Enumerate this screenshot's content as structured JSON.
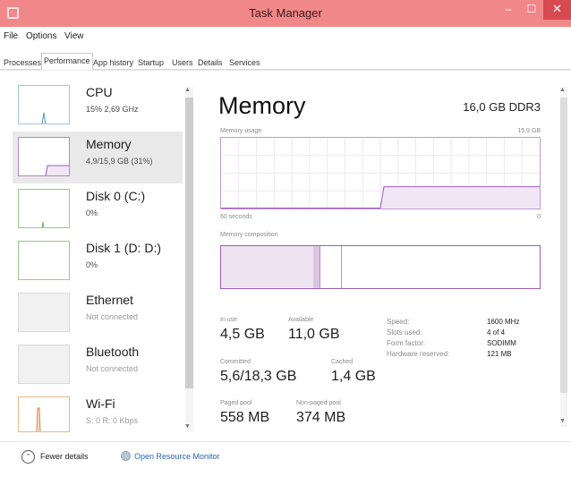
{
  "window": {
    "title": "Task Manager",
    "minimize_glyph": "–",
    "maximize_glyph": "☐",
    "close_glyph": "✕",
    "accent_color": "#f0888a"
  },
  "menu": [
    "File",
    "Options",
    "View"
  ],
  "tabs": [
    {
      "label": "Processes",
      "active": false
    },
    {
      "label": "Performance",
      "active": true
    },
    {
      "label": "App history",
      "active": false
    },
    {
      "label": "Startup",
      "active": false
    },
    {
      "label": "Users",
      "active": false
    },
    {
      "label": "Details",
      "active": false
    },
    {
      "label": "Services",
      "active": false
    }
  ],
  "sidebar": {
    "items": [
      {
        "name": "CPU",
        "sub": "15% 2,69 GHz",
        "icon": "cpu-graph-thumbnail"
      },
      {
        "name": "Memory",
        "sub": "4,9/15,9 GB (31%)",
        "icon": "memory-graph-thumbnail",
        "selected": true
      },
      {
        "name": "Disk 0 (C:)",
        "sub": "0%",
        "icon": "disk-graph-thumbnail"
      },
      {
        "name": "Disk 1 (D: D:)",
        "sub": "0%",
        "icon": "disk-graph-thumbnail"
      },
      {
        "name": "Ethernet",
        "sub": "Not connected",
        "icon": "ethernet-graph-thumbnail"
      },
      {
        "name": "Bluetooth",
        "sub": "Not connected",
        "icon": "bluetooth-graph-thumbnail"
      },
      {
        "name": "Wi-Fi",
        "sub": "S: 0 R: 0 Kbps",
        "icon": "wifi-graph-thumbnail"
      }
    ],
    "scroll_up_glyph": "▲",
    "scroll_down_glyph": "▼"
  },
  "memory": {
    "title": "Memory",
    "spec": "16,0 GB DDR3",
    "usage_graph": {
      "label": "Memory usage",
      "max_label": "15,9 GB",
      "time_label": "60 seconds",
      "min_label": "0",
      "line_color": "#9b5fb5",
      "fill_color": "#f1e6f5",
      "usage_before_gb": 0,
      "usage_after_gb": 4.9,
      "max_gb": 15.9,
      "step_at_fraction": 0.5
    },
    "composition": {
      "label": "Memory composition",
      "in_use_fraction": 0.29,
      "modified_fraction": 0.02
    },
    "stats": {
      "in_use_label": "In use",
      "in_use_value": "4,5 GB",
      "available_label": "Available",
      "available_value": "11,0 GB",
      "committed_label": "Committed",
      "committed_value": "5,6/18,3 GB",
      "cached_label": "Cached",
      "cached_value": "1,4 GB",
      "paged_label": "Paged pool",
      "paged_value": "558 MB",
      "nonpaged_label": "Non-paged pool",
      "nonpaged_value": "374 MB"
    },
    "props": [
      {
        "label": "Speed:",
        "value": "1600 MHz"
      },
      {
        "label": "Slots used:",
        "value": "4 of 4"
      },
      {
        "label": "Form factor:",
        "value": "SODIMM"
      },
      {
        "label": "Hardware reserved:",
        "value": "121 MB"
      }
    ]
  },
  "footer": {
    "fewer_details": "Fewer details",
    "fewer_glyph": "⌃",
    "open_monitor": "Open Resource Monitor"
  }
}
